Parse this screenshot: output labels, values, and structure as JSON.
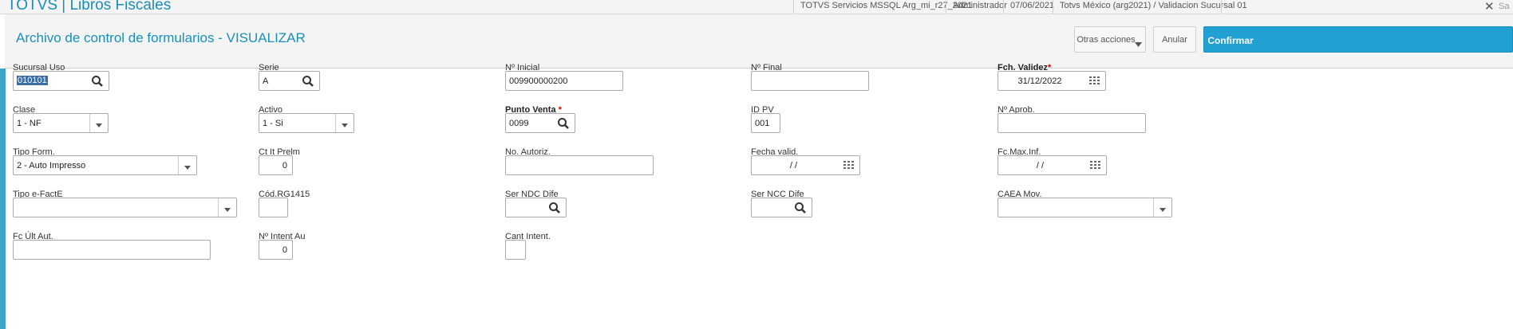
{
  "topbar": {
    "app_title": "TOTVS | Libros Fiscales",
    "environment": "TOTVS Servicios MSSQL Arg_mi_r27_2021",
    "user": "Administrador",
    "date": "07/06/2021",
    "company": "Totvs México (arg2021) / Validacion Sucursal 01",
    "close_glyph": "✕",
    "sa_text": "Sa"
  },
  "header": {
    "title": "Archivo de control de formularios - VISUALIZAR",
    "more_actions": "Otras acciones",
    "cancel": "Anular",
    "confirm": "Confirmar"
  },
  "fields": {
    "sucursal_uso": {
      "label": "Sucursal Uso",
      "value": "010101"
    },
    "serie": {
      "label": "Serie",
      "value": "A"
    },
    "nro_inicial": {
      "label": "Nº Inicial",
      "value": "009900000200"
    },
    "nro_final": {
      "label": "Nº Final",
      "value": ""
    },
    "fch_validez": {
      "label": "Fch. Validez",
      "required": "*",
      "value": "31/12/2022"
    },
    "clase": {
      "label": "Clase",
      "value": "1 - NF"
    },
    "activo": {
      "label": "Activo",
      "value": "1 - Si"
    },
    "punto_venta": {
      "label": "Punto Venta",
      "required": "*",
      "value": "0099"
    },
    "id_pv": {
      "label": "ID PV",
      "value": "001"
    },
    "nro_aprob": {
      "label": "Nº Aprob.",
      "value": ""
    },
    "tipo_form": {
      "label": "Tipo Form.",
      "value": "2 - Auto Impresso"
    },
    "ct_it_prelm": {
      "label": "Ct It Prelm",
      "value": "0"
    },
    "no_autoriz": {
      "label": "No. Autoriz.",
      "value": ""
    },
    "fecha_valid": {
      "label": "Fecha valid.",
      "value": "/ /"
    },
    "fc_max_inf": {
      "label": "Fc.Max.Inf.",
      "value": "/ /"
    },
    "tipo_efacte": {
      "label": "Tipo e-FactE",
      "value": ""
    },
    "cod_rg1415": {
      "label": "Cód.RG1415",
      "value": ""
    },
    "ser_ndc_dife": {
      "label": "Ser NDC Dife",
      "value": ""
    },
    "ser_ncc_dife": {
      "label": "Ser NCC Dife",
      "value": ""
    },
    "caea_mov": {
      "label": "CAEA Mov.",
      "value": ""
    },
    "fc_ult_aut": {
      "label": "Fc Últ Aut.",
      "value": ""
    },
    "nro_intent_au": {
      "label": "Nº Intent Au",
      "value": "0"
    },
    "cant_intent": {
      "label": "Cant Intent.",
      "value": ""
    }
  },
  "colors": {
    "accent": "#1a8fb5",
    "primary_button": "#21a0d2",
    "required": "#dd0000"
  }
}
